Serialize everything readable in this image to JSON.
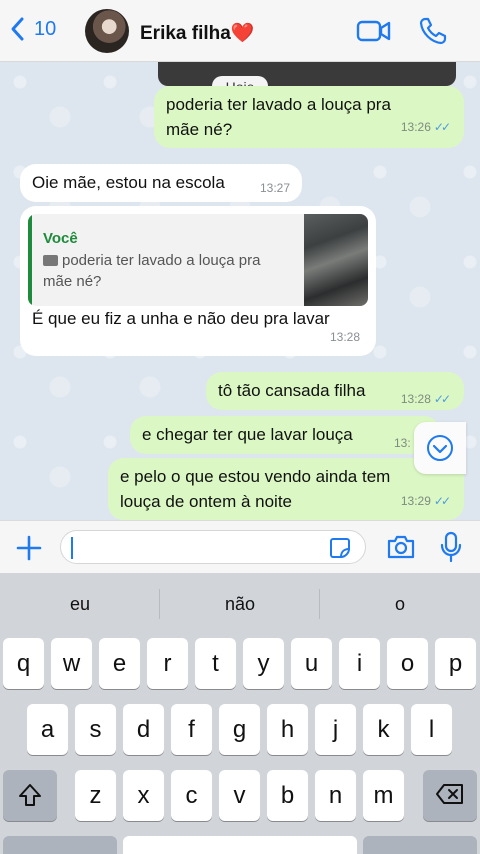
{
  "header": {
    "back_count": "10",
    "contact_name": "Erika filha",
    "contact_emoji": "❤️"
  },
  "chat": {
    "date_chip": "Hoje",
    "messages": [
      {
        "dir": "out",
        "text_line1": "poderia ter lavado a louça pra",
        "text_line2": "mãe né?",
        "time": "13:26",
        "status": "read"
      },
      {
        "dir": "in",
        "text": "Oie mãe, estou na escola",
        "time": "13:27"
      },
      {
        "dir": "in",
        "reply_author": "Você",
        "reply_text_line1": "poderia ter lavado a louça pra",
        "reply_text_line2": "mãe né?",
        "text": "É que eu fiz a unha e não deu pra lavar",
        "time": "13:28"
      },
      {
        "dir": "out",
        "text": "tô tão cansada filha",
        "time": "13:28",
        "status": "read"
      },
      {
        "dir": "out",
        "text": "e chegar ter que lavar louça",
        "time": "13:",
        "status": "read"
      },
      {
        "dir": "out",
        "text_line1": "e pelo o que estou vendo ainda tem",
        "text_line2": "louça de ontem à noite",
        "time": "13:29",
        "status": "read"
      }
    ]
  },
  "keyboard": {
    "suggestions": [
      "eu",
      "não",
      "o"
    ],
    "row1": [
      "q",
      "w",
      "e",
      "r",
      "t",
      "y",
      "u",
      "i",
      "o",
      "p"
    ],
    "row2": [
      "a",
      "s",
      "d",
      "f",
      "g",
      "h",
      "j",
      "k",
      "l"
    ],
    "row3": [
      "z",
      "x",
      "c",
      "v",
      "b",
      "n",
      "m"
    ]
  },
  "colors": {
    "accent": "#1f7af0",
    "outgoing_bubble": "#dbf8c4",
    "incoming_bubble": "#ffffff",
    "reply_author": "#1e8a3c",
    "read_ticks": "#4e9be0"
  },
  "icons": [
    "back-chevron-icon",
    "video-call-icon",
    "phone-icon",
    "plus-icon",
    "sticker-icon",
    "camera-icon",
    "microphone-icon",
    "shift-icon",
    "backspace-icon",
    "chevron-down-icon"
  ]
}
